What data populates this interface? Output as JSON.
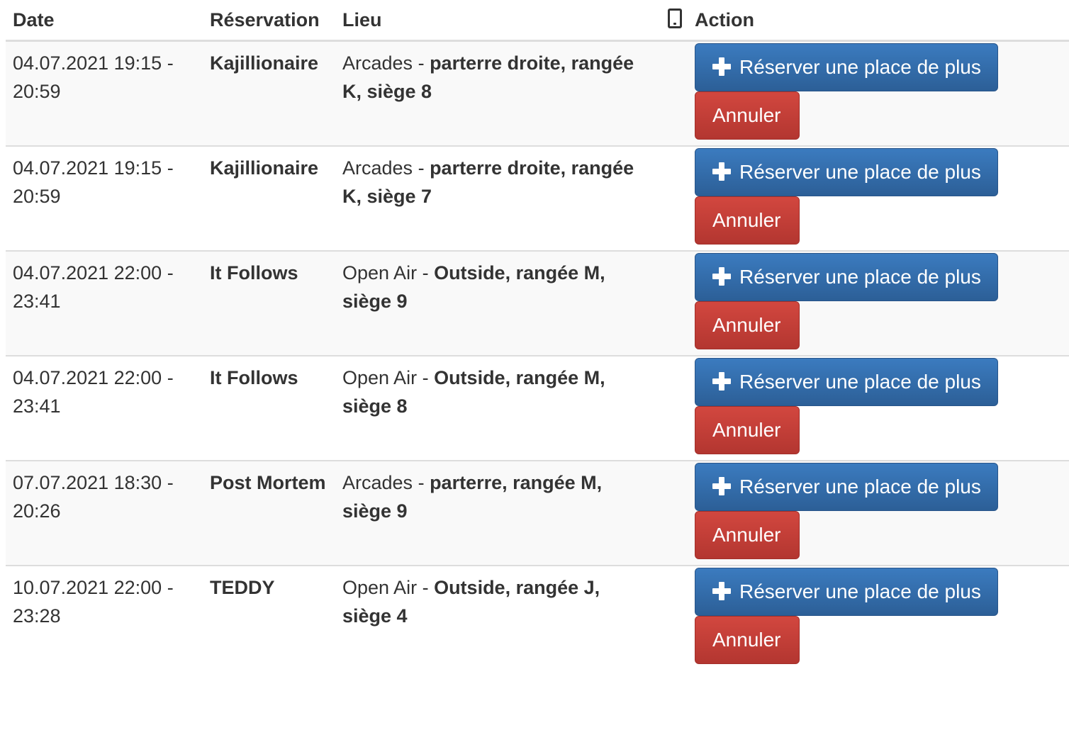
{
  "table": {
    "headers": {
      "date": "Date",
      "reservation": "Réservation",
      "lieu": "Lieu",
      "action": "Action"
    },
    "mobile_icon": "mobile-phone-icon",
    "rows": [
      {
        "date_line1": "04.07.2021 19:15 -",
        "date_line2": "20:59",
        "film": "Kajillionaire",
        "venue": "Arcades",
        "separator": " - ",
        "seat": "parterre droite, rangée K, siège 8"
      },
      {
        "date_line1": "04.07.2021 19:15 -",
        "date_line2": "20:59",
        "film": "Kajillionaire",
        "venue": "Arcades",
        "separator": " - ",
        "seat": "parterre droite, rangée K, siège 7"
      },
      {
        "date_line1": "04.07.2021 22:00 -",
        "date_line2": "23:41",
        "film": "It Follows",
        "venue": "Open Air",
        "separator": " - ",
        "seat": "Outside, rangée M, siège 9"
      },
      {
        "date_line1": "04.07.2021 22:00 -",
        "date_line2": "23:41",
        "film": "It Follows",
        "venue": "Open Air",
        "separator": " - ",
        "seat": "Outside, rangée M, siège 8"
      },
      {
        "date_line1": "07.07.2021 18:30 -",
        "date_line2": "20:26",
        "film": "Post Mortem",
        "venue": "Arcades",
        "separator": " - ",
        "seat": "parterre, rangée M, siège 9"
      },
      {
        "date_line1": "10.07.2021 22:00 -",
        "date_line2": "23:28",
        "film": "TEDDY",
        "venue": "Open Air",
        "separator": " - ",
        "seat": "Outside, rangée J, siège 4"
      }
    ]
  },
  "buttons": {
    "reserve_label": "Réserver une place de plus",
    "cancel_label": "Annuler",
    "reserve_icon": "plus-icon"
  },
  "colors": {
    "primary": "#337ab7",
    "danger": "#c9302c",
    "row_stripe": "#f9f9f9",
    "border": "#dddddd"
  }
}
